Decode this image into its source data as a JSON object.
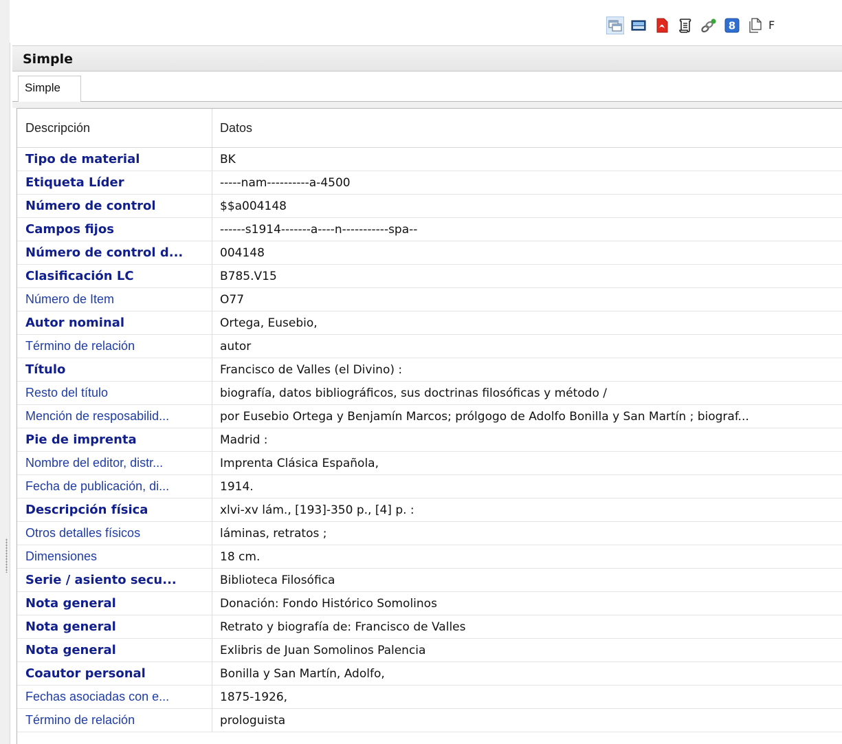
{
  "toolbar": {
    "icons": [
      {
        "name": "window-view-icon",
        "active": true
      },
      {
        "name": "display-view-icon",
        "active": false
      },
      {
        "name": "pdf-icon",
        "active": false
      },
      {
        "name": "script-icon",
        "active": false
      },
      {
        "name": "link-chain-icon",
        "active": false
      },
      {
        "name": "google-icon",
        "active": false
      },
      {
        "name": "document-copy-icon",
        "active": false
      }
    ],
    "cut_label": "F"
  },
  "panel": {
    "title": "Simple"
  },
  "tabs": [
    {
      "label": "Simple",
      "selected": true
    }
  ],
  "colors": {
    "label_blue": "#111f8c",
    "label_blue_light": "#1f3ca6"
  },
  "table": {
    "headers": {
      "desc": "Descripción",
      "data": "Datos"
    },
    "rows": [
      {
        "label": "Tipo de material",
        "value": "BK",
        "bold": true
      },
      {
        "label": "Etiqueta Líder",
        "value": "-----nam----------a-4500",
        "bold": true
      },
      {
        "label": "Número de control",
        "value": "$$a004148",
        "bold": true
      },
      {
        "label": "Campos fijos",
        "value": "------s1914-------a----n-----------spa--",
        "bold": true
      },
      {
        "label": "Número de control d...",
        "value": "004148",
        "bold": true
      },
      {
        "label": "Clasificación LC",
        "value": "B785.V15",
        "bold": true
      },
      {
        "label": "Número de Item",
        "value": "O77",
        "bold": false
      },
      {
        "label": "Autor nominal",
        "value": "Ortega, Eusebio,",
        "bold": true
      },
      {
        "label": "Término de relación",
        "value": "autor",
        "bold": false
      },
      {
        "label": "Título",
        "value": "Francisco de Valles (el Divino) :",
        "bold": true
      },
      {
        "label": "Resto del título",
        "value": "biografía, datos bibliográficos, sus doctrinas filosóficas y método /",
        "bold": false
      },
      {
        "label": "Mención de resposabilid...",
        "value": "por Eusebio Ortega y Benjamín Marcos; prólgogo de Adolfo Bonilla y San Martín ; biograf...",
        "bold": false
      },
      {
        "label": "Pie de imprenta",
        "value": "Madrid :",
        "bold": true
      },
      {
        "label": "Nombre del editor, distr...",
        "value": "Imprenta Clásica Española,",
        "bold": false
      },
      {
        "label": "Fecha de publicación, di...",
        "value": "1914.",
        "bold": false
      },
      {
        "label": "Descripción física",
        "value": "xlvi-xv lám., [193]-350 p., [4] p. :",
        "bold": true
      },
      {
        "label": "Otros detalles físicos",
        "value": "láminas, retratos ;",
        "bold": false
      },
      {
        "label": "Dimensiones",
        "value": "18 cm.",
        "bold": false
      },
      {
        "label": "Serie / asiento secu...",
        "value": "Biblioteca Filosófica",
        "bold": true
      },
      {
        "label": "Nota general",
        "value": "Donación: Fondo Histórico Somolinos",
        "bold": true
      },
      {
        "label": "Nota general",
        "value": "Retrato y biografía de: Francisco de Valles",
        "bold": true
      },
      {
        "label": "Nota general",
        "value": "Exlibris de Juan Somolinos Palencia",
        "bold": true
      },
      {
        "label": "Coautor personal",
        "value": "Bonilla y San Martín, Adolfo,",
        "bold": true
      },
      {
        "label": "Fechas asociadas con e...",
        "value": "1875-1926,",
        "bold": false
      },
      {
        "label": "Término de relación",
        "value": "prologuista",
        "bold": false
      }
    ]
  }
}
